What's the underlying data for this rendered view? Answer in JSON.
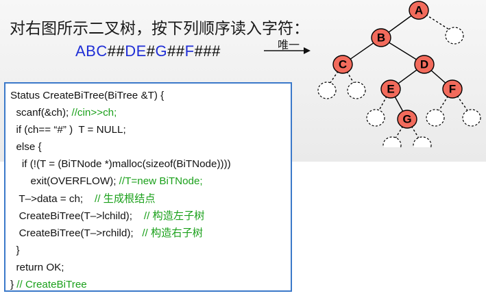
{
  "heading": "对右图所示二叉树，按下列顺序读入字符：",
  "sequence": [
    {
      "t": "ABC",
      "k": "letter"
    },
    {
      "t": "##",
      "k": "hash"
    },
    {
      "t": "DE",
      "k": "letter"
    },
    {
      "t": "#",
      "k": "hash"
    },
    {
      "t": "G",
      "k": "letter"
    },
    {
      "t": "##",
      "k": "hash"
    },
    {
      "t": "F",
      "k": "letter"
    },
    {
      "t": "###",
      "k": "hash"
    }
  ],
  "arrow_label": "唯一",
  "tree": {
    "nodes": [
      "A",
      "B",
      "C",
      "D",
      "E",
      "F",
      "G"
    ]
  },
  "code": [
    {
      "indent": "",
      "code": "Status CreateBiTree(BiTree &T) {",
      "comment": ""
    },
    {
      "indent": "  ",
      "code": "scanf(&ch); ",
      "comment": "//cin>>ch;"
    },
    {
      "indent": "  ",
      "code": "if (ch== “#” )  T = NULL;",
      "comment": ""
    },
    {
      "indent": "  ",
      "code": "else {",
      "comment": ""
    },
    {
      "indent": "    ",
      "code": "if (!(T = (BiTNode *)malloc(sizeof(BiTNode))))",
      "comment": ""
    },
    {
      "indent": "       ",
      "code": "exit(OVERFLOW); ",
      "comment": "//T=new BiTNode;"
    },
    {
      "indent": "   ",
      "code": "T–>data = ch;    ",
      "comment": "// 生成根结点"
    },
    {
      "indent": "   ",
      "code": "CreateBiTree(T–>lchild);    ",
      "comment": "// 构造左子树"
    },
    {
      "indent": "   ",
      "code": "CreateBiTree(T–>rchild);   ",
      "comment": "// 构造右子树"
    },
    {
      "indent": "  ",
      "code": "}",
      "comment": ""
    },
    {
      "indent": "  ",
      "code": "return OK;",
      "comment": ""
    },
    {
      "indent": "",
      "code": "} ",
      "comment": "// CreateBiTree"
    }
  ],
  "colors": {
    "sequence_letter": "#1f2ed6",
    "sequence_hash": "#000000",
    "node_fill": "#f26b5c",
    "code_border": "#3a78c9",
    "comment": "#1aa01a"
  }
}
